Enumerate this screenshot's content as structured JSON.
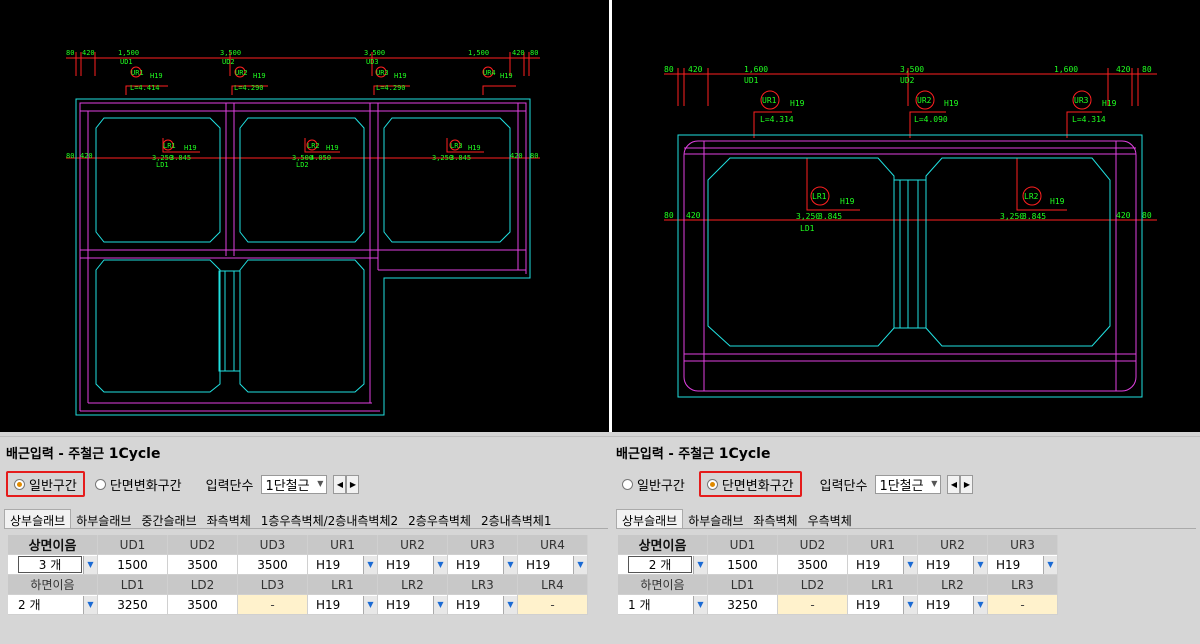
{
  "left_panel": {
    "title_prefix": "배근입력 - 주철근",
    "title_cycle": "1Cycle",
    "radio_general": "일반구간",
    "radio_section": "단면변화구간",
    "input_label": "입력단수",
    "combo_value": "1단철근",
    "tabs": [
      "상부슬래브",
      "하부슬래브",
      "중간슬래브",
      "좌측벽체",
      "1층우측벽체/2층내측벽체2",
      "2층우측벽체",
      "2층내측벽체1"
    ],
    "top_header": [
      "상면이음",
      "UD1",
      "UD2",
      "UD3",
      "UR1",
      "UR2",
      "UR3",
      "UR4"
    ],
    "top_values": [
      "3 개",
      "1500",
      "3500",
      "3500",
      "H19",
      "H19",
      "H19",
      "H19"
    ],
    "bottom_header": [
      "하면이음",
      "LD1",
      "LD2",
      "LD3",
      "LR1",
      "LR2",
      "LR3",
      "LR4"
    ],
    "bottom_values": [
      "2 개",
      "3250",
      "3500",
      "-",
      "H19",
      "H19",
      "H19",
      "-"
    ]
  },
  "right_panel": {
    "title_prefix": "배근입력 - 주철근",
    "title_cycle": "1Cycle",
    "radio_general": "일반구간",
    "radio_section": "단면변화구간",
    "input_label": "입력단수",
    "combo_value": "1단철근",
    "tabs": [
      "상부슬래브",
      "하부슬래브",
      "좌측벽체",
      "우측벽체"
    ],
    "top_header": [
      "상면이음",
      "UD1",
      "UD2",
      "UR1",
      "UR2",
      "UR3"
    ],
    "top_values": [
      "2 개",
      "1500",
      "3500",
      "H19",
      "H19",
      "H19"
    ],
    "bottom_header": [
      "하면이음",
      "LD1",
      "LD2",
      "LR1",
      "LR2",
      "LR3"
    ],
    "bottom_values": [
      "1 개",
      "3250",
      "-",
      "H19",
      "H19",
      "-"
    ]
  },
  "cad_left": {
    "dims_top": [
      "80",
      "420",
      "1,500",
      "3,500",
      "3,500",
      "1,500",
      "420",
      "80"
    ],
    "ud": [
      "UD1",
      "UD2",
      "UD3"
    ],
    "ur": [
      "UR1",
      "UR2",
      "UR3",
      "UR4"
    ],
    "ur_len": [
      "L=4.414",
      "L=4.290",
      "L=4.290"
    ],
    "h19": "H19",
    "lr": [
      "LR1",
      "LR2",
      "LR3"
    ],
    "ld": [
      "LD1",
      "LD2"
    ],
    "lr_len": [
      "3,250",
      "3,500",
      "3,250"
    ],
    "lr_len2": [
      "3.845",
      "4.050",
      "3.845"
    ],
    "side_dims": [
      "80",
      "420"
    ]
  },
  "cad_right": {
    "dims_top": [
      "80",
      "420",
      "1,600",
      "3,500",
      "1,600",
      "420",
      "80"
    ],
    "ud": [
      "UD1",
      "UD2"
    ],
    "ur": [
      "UR1",
      "UR2",
      "UR3"
    ],
    "ur_len": [
      "L=4.314",
      "L=4.090",
      "L=4.314"
    ],
    "h19": "H19",
    "lr": [
      "LR1",
      "LR2"
    ],
    "ld": [
      "LD1"
    ],
    "lr_len": [
      "3,250",
      "3,250"
    ],
    "lr_len2": [
      "3.845",
      "3.845"
    ],
    "side_dims": [
      "80",
      "420"
    ]
  },
  "colors": {
    "cad_bg": "#000000",
    "magenta": "#e040e0",
    "cyan": "#20e0e0",
    "red": "#ff2020",
    "green": "#20ff20",
    "highlight": "#e51c1c"
  }
}
